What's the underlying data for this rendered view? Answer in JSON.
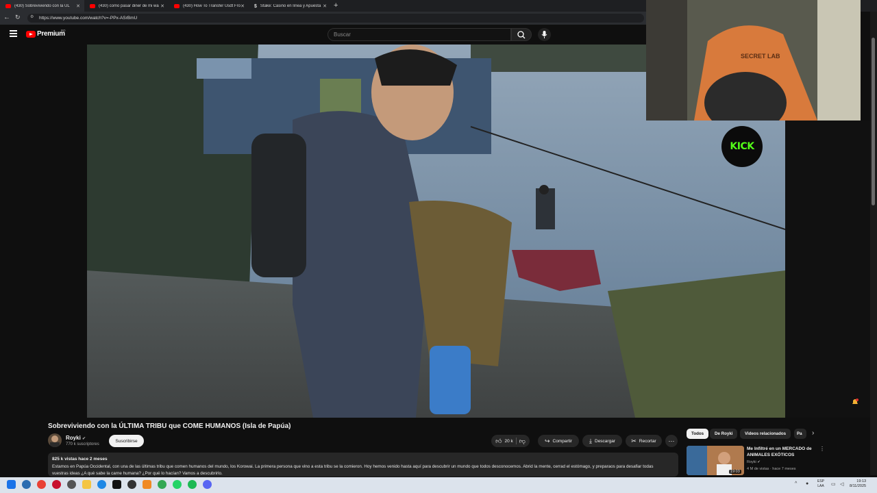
{
  "browser": {
    "tabs": [
      {
        "label": "(430) Sobreviviendo con la ÚL",
        "color": "#ff0000"
      },
      {
        "label": "(430) como pasar diner de mi wa",
        "color": "#ff0000"
      },
      {
        "label": "(430) How To Transfer Usdt From",
        "color": "#ff0000"
      },
      {
        "label": "Stake: Casino en línea y Apuesta",
        "color": "#dddddd"
      }
    ],
    "new_tab": "+",
    "url": "https://www.youtube.com/watch?v=-PPx-ASrBmU"
  },
  "youtube": {
    "brand": "Premium",
    "brand_country": "BO",
    "search_placeholder": "Buscar"
  },
  "overlay": {
    "cam_brand": "SECRET LAB",
    "kick_logo": "KICK"
  },
  "video": {
    "title": "Sobreviviendo con la ÚLTIMA TRIBU que COME HUMANOS (Isla de Papúa)",
    "channel": "Royki",
    "subscribers": "770 k suscriptores",
    "subscribe_label": "Suscribirse",
    "likes": "20 k",
    "share_label": "Compartir",
    "download_label": "Descargar",
    "clip_label": "Recortar",
    "views_date": "825 k vistas  hace 2 meses",
    "description": "Estamos en Papúa Occidental, con una de las últimas tribu que comen humanos del mundo, los Korowai. La primera persona que vino a esta tribu se la comieron. Hoy hemos venido hasta aquí para descubrir un mundo que todos desconocemos. Abrid la mente, cerrad el estómago, y preparaos para desafiar todas vuestras ideas ¿A qué sabe la carne humana? ¿Por qué lo hacían? Vamos a descubrirlo."
  },
  "chips": [
    "Todos",
    "De Royki",
    "Videos relacionados",
    "Pa"
  ],
  "recommendation": {
    "title": "Me Infiltré en un MERCADO de ANIMALES EXÓTICOS",
    "channel": "Royki",
    "meta": "4 M de vistas · hace 7 meses",
    "duration": "19:03"
  },
  "taskbar": {
    "lang": "ESP\nLAA",
    "time": "19:13",
    "date": "8/11/2025",
    "icons": [
      "windows-start",
      "copilot",
      "chrome",
      "opera",
      "settings",
      "file-explorer",
      "edge",
      "tiktok",
      "obs",
      "vlc",
      "chrome-2",
      "whatsapp",
      "spotify",
      "discord"
    ]
  },
  "colors": {
    "yt_red": "#ff0000",
    "kick_green": "#53fc18",
    "background": "#0f0f0f"
  }
}
